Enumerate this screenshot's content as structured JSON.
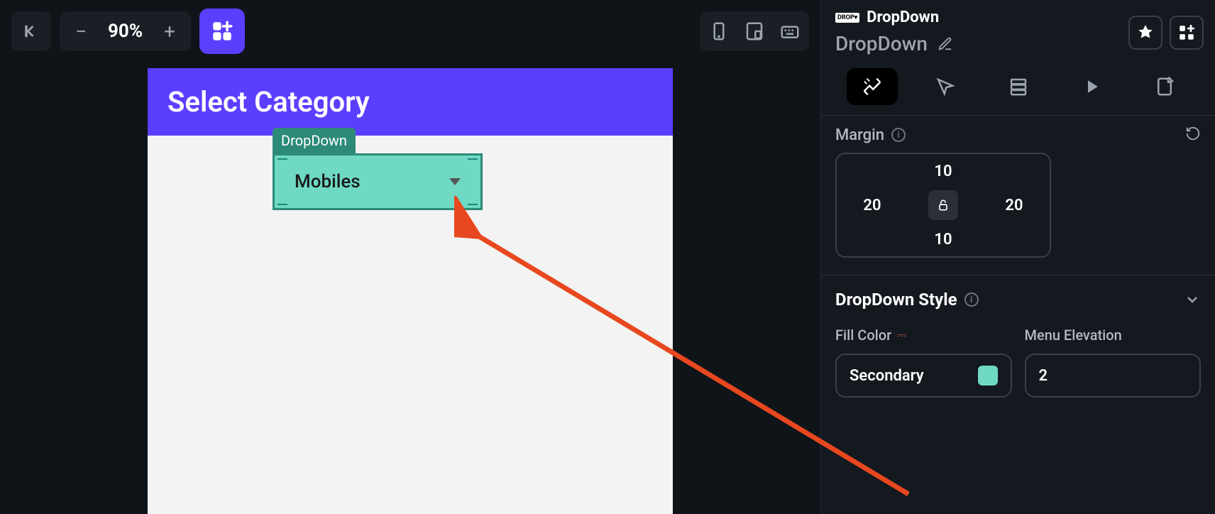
{
  "toolbar": {
    "zoom": "90%"
  },
  "canvas": {
    "header_title": "Select Category",
    "dropdown_tag": "DropDown",
    "dropdown_value": "Mobiles"
  },
  "panel": {
    "crumb": "DropDown",
    "title": "DropDown",
    "margin": {
      "label": "Margin",
      "top": "10",
      "right": "20",
      "bottom": "10",
      "left": "20"
    },
    "style_section": "DropDown Style",
    "fill_color": {
      "label": "Fill Color",
      "value": "Secondary",
      "swatch": "#6FD9C4"
    },
    "menu_elevation": {
      "label": "Menu Elevation",
      "value": "2"
    }
  }
}
